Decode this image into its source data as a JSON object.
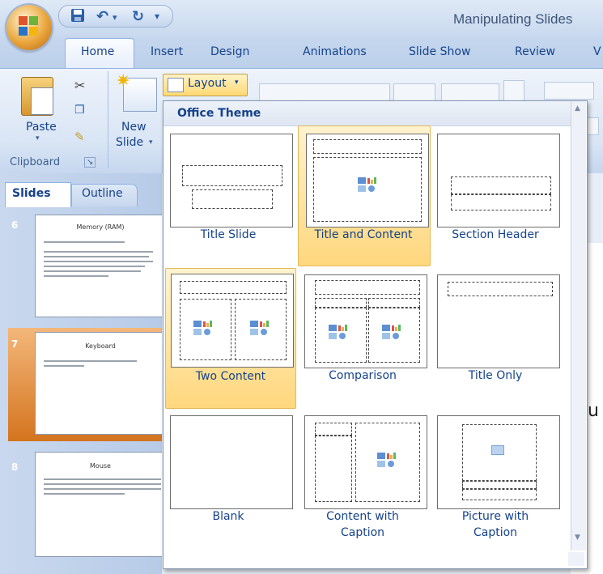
{
  "window": {
    "title": "Manipulating Slides"
  },
  "quick_access": {
    "icons": [
      "save-icon",
      "undo-icon",
      "redo-icon",
      "customize-icon"
    ]
  },
  "tabs": [
    {
      "label": "Home",
      "selected": true
    },
    {
      "label": "Insert"
    },
    {
      "label": "Design"
    },
    {
      "label": "Animations"
    },
    {
      "label": "Slide Show"
    },
    {
      "label": "Review"
    },
    {
      "label": "V"
    }
  ],
  "ribbon": {
    "paste_label": "Paste",
    "new_slide_label_1": "New",
    "new_slide_label_2": "Slide",
    "layout_label": "Layout",
    "clipboard_label": "Clipboard"
  },
  "slides_pane": {
    "tabs": [
      "Slides",
      "Outline"
    ],
    "slides": [
      {
        "number": "6",
        "title": "Memory (RAM)"
      },
      {
        "number": "7",
        "title": "Keyboard"
      },
      {
        "number": "8",
        "title": "Mouse"
      }
    ]
  },
  "main_text": "u",
  "layout_gallery": {
    "header": "Office Theme",
    "layouts": [
      {
        "label": "Title Slide"
      },
      {
        "label": "Title and Content",
        "hovered": true
      },
      {
        "label": "Section Header"
      },
      {
        "label": "Two Content",
        "selected": true
      },
      {
        "label": "Comparison"
      },
      {
        "label": "Title Only"
      },
      {
        "label": "Blank"
      },
      {
        "label": "Content with",
        "label2": "Caption"
      },
      {
        "label": "Picture with",
        "label2": "Caption"
      }
    ]
  },
  "colors": {
    "accent": "#15428b",
    "selected_fill": "#ffd77d",
    "ribbon": "#d9e5f5"
  }
}
